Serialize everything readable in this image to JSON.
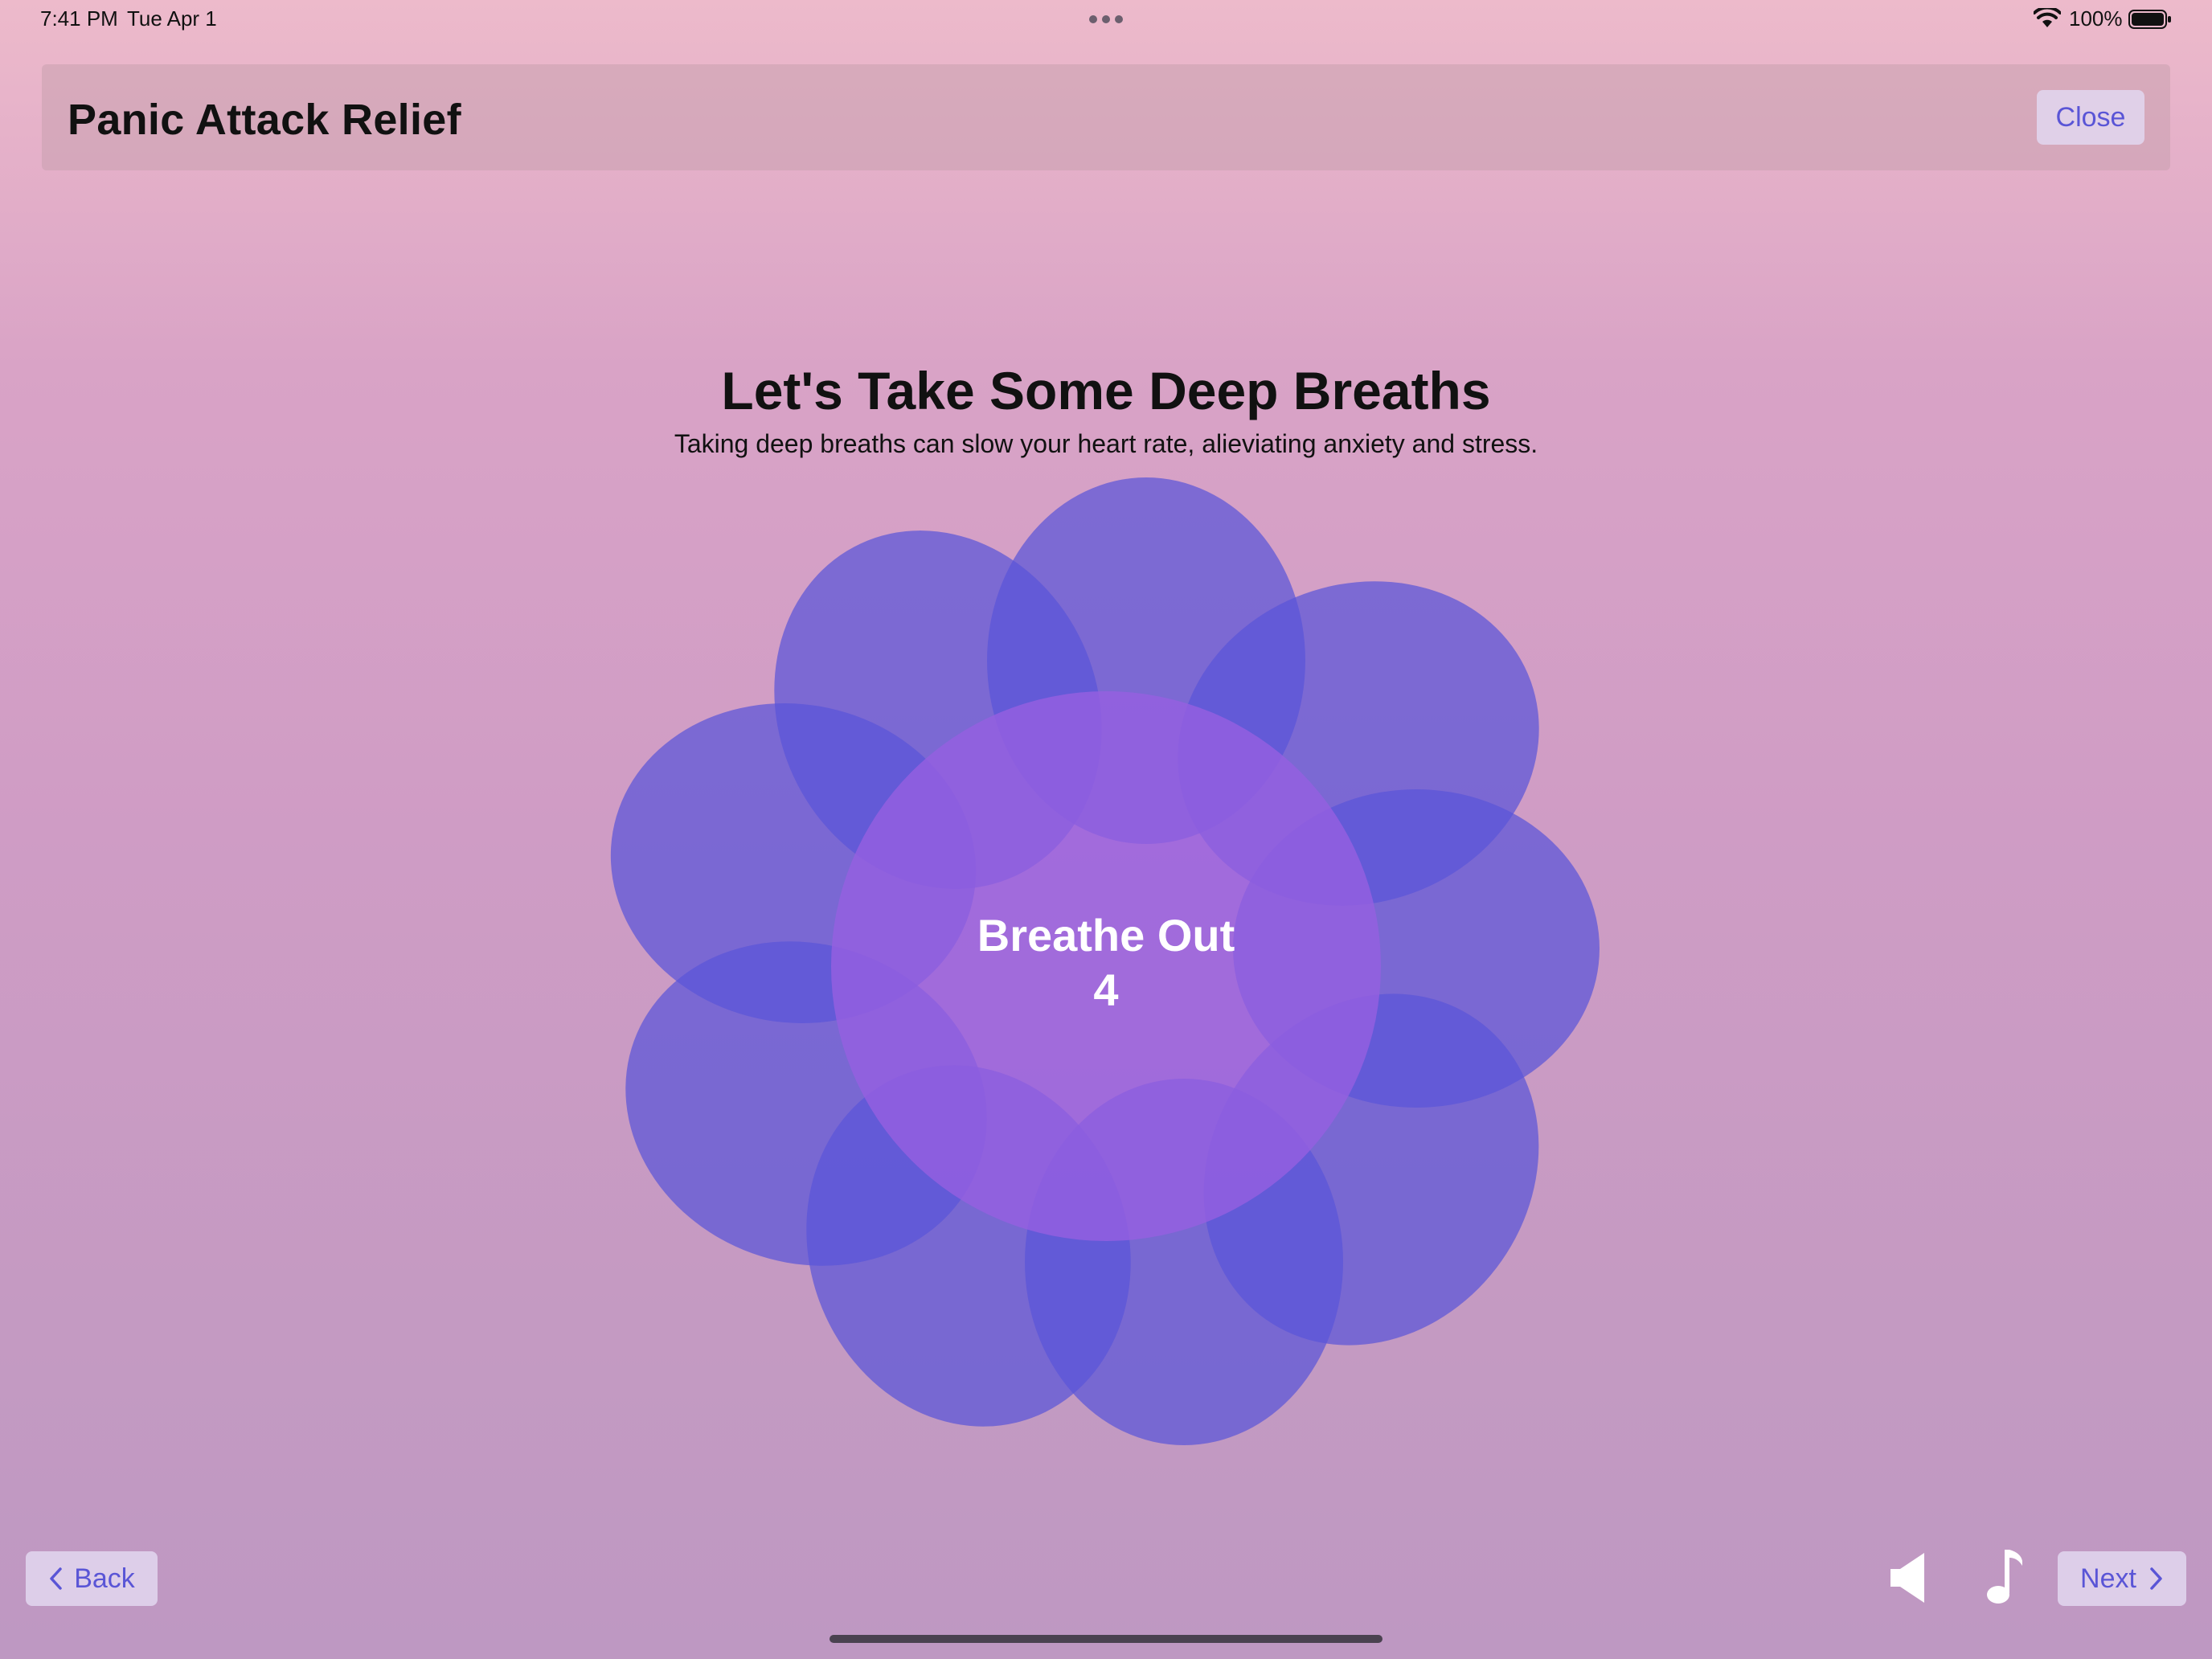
{
  "status_bar": {
    "time": "7:41 PM",
    "date": "Tue Apr 1",
    "battery_percent": "100%",
    "wifi_icon": "wifi-icon",
    "battery_icon": "battery-full-icon"
  },
  "nav": {
    "title": "Panic Attack Relief",
    "close_label": "Close"
  },
  "content": {
    "heading": "Let's Take Some Deep Breaths",
    "subheading": "Taking deep breaths can slow your heart rate, alieviating anxiety and stress.",
    "breath_phase": "Breathe Out",
    "breath_count": "4"
  },
  "footer": {
    "back_label": "Back",
    "next_label": "Next",
    "speaker_icon": "speaker-icon",
    "music_icon": "music-note-icon"
  },
  "colors": {
    "accent": "#5a55d6",
    "petal": "#5a55d8",
    "center": "#8f5ce0"
  }
}
